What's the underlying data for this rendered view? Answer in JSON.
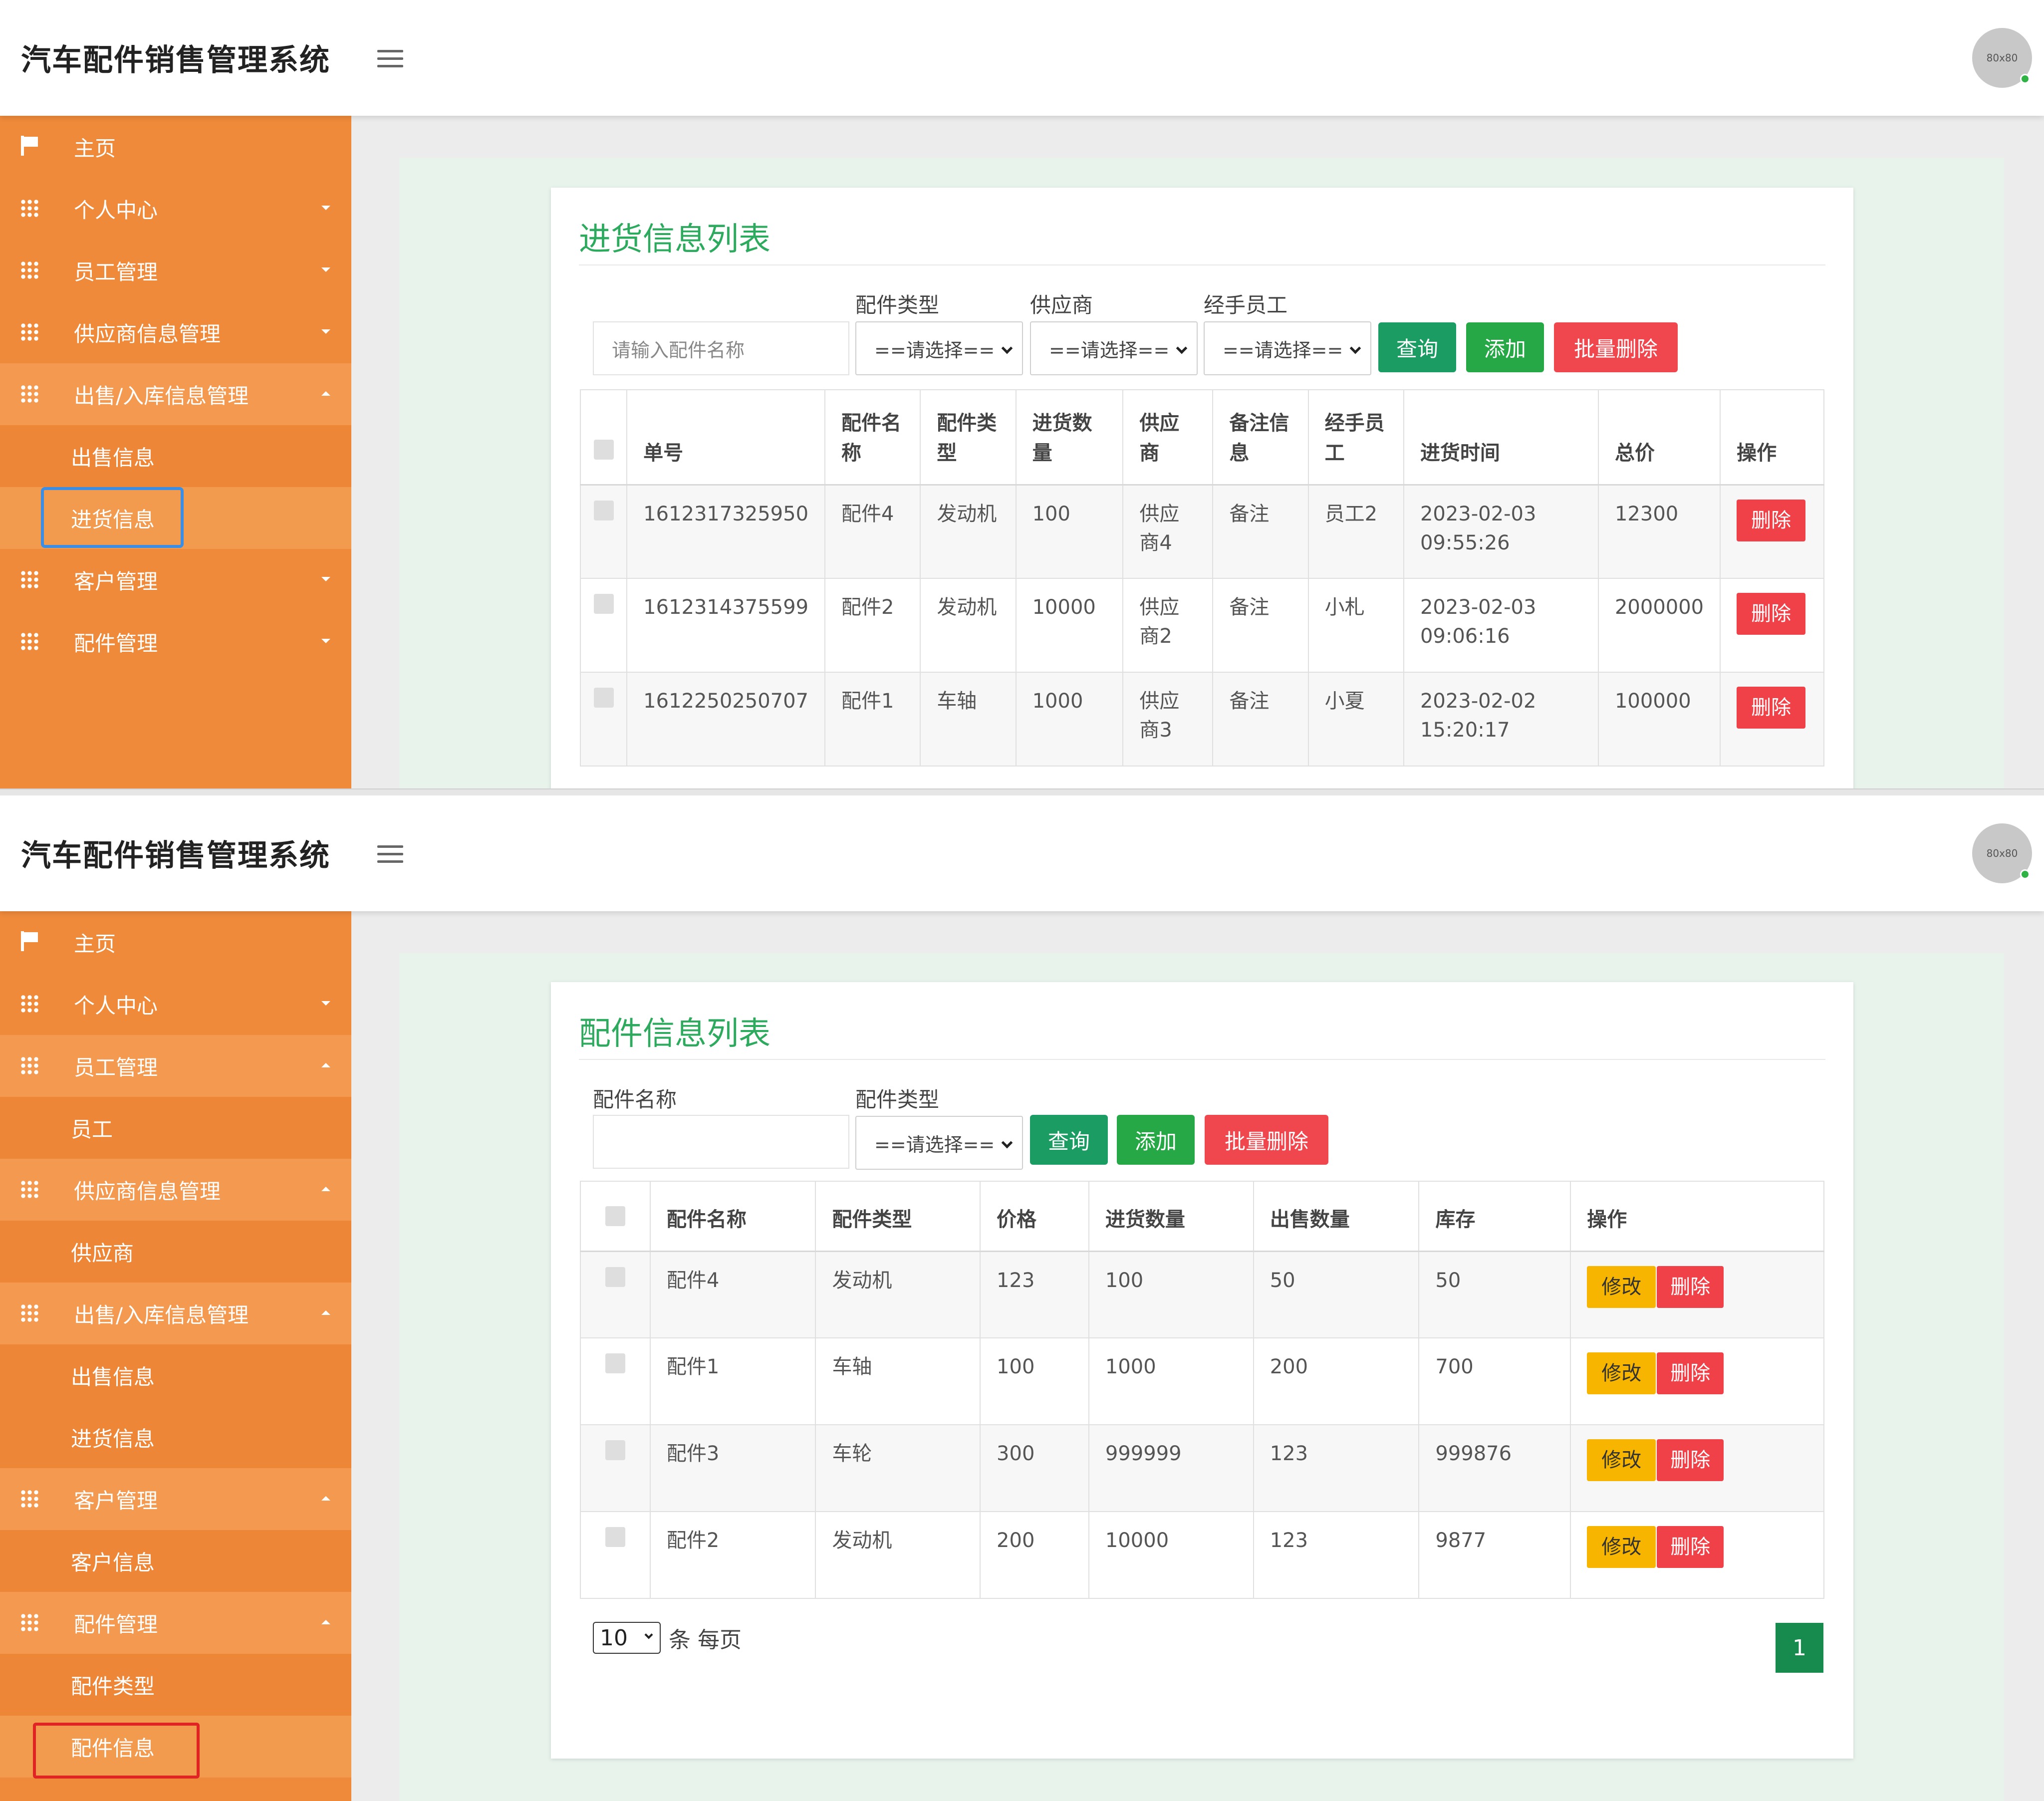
{
  "app_title": "汽车配件销售管理系统",
  "avatar_text": "80x80",
  "colors": {
    "sidebar": "#ef8a3a",
    "accent_green": "#2eaa5f",
    "danger": "#f04048",
    "warning": "#f7b500"
  },
  "shot1": {
    "sidebar": {
      "home": "主页",
      "personal": "个人中心",
      "staff": "员工管理",
      "supplier": "供应商信息管理",
      "inout": "出售/入库信息管理",
      "sales": "出售信息",
      "purchase": "进货信息",
      "customer": "客户管理",
      "parts": "配件管理"
    },
    "panel_title": "进货信息列表",
    "filters": {
      "name_placeholder": "请输入配件名称",
      "type_label": "配件类型",
      "supplier_label": "供应商",
      "staff_label": "经手员工",
      "select_default": "==请选择=="
    },
    "buttons": {
      "query": "查询",
      "add": "添加",
      "batch_delete": "批量删除",
      "delete": "删除"
    },
    "table": {
      "headers": {
        "order": "单号",
        "name": "配件名称",
        "type": "配件类型",
        "qty": "进货数量",
        "supplier": "供应商",
        "remark": "备注信息",
        "staff": "经手员工",
        "time": "进货时间",
        "total": "总价",
        "ops": "操作"
      },
      "rows": [
        {
          "order": "1612317325950",
          "name": "配件4",
          "type": "发动机",
          "qty": "100",
          "supplier": "供应商4",
          "remark": "备注",
          "staff": "员工2",
          "time": "2023-02-03 09:55:26",
          "total": "12300"
        },
        {
          "order": "1612314375599",
          "name": "配件2",
          "type": "发动机",
          "qty": "10000",
          "supplier": "供应商2",
          "remark": "备注",
          "staff": "小札",
          "time": "2023-02-03 09:06:16",
          "total": "2000000"
        },
        {
          "order": "1612250250707",
          "name": "配件1",
          "type": "车轴",
          "qty": "1000",
          "supplier": "供应商3",
          "remark": "备注",
          "staff": "小夏",
          "time": "2023-02-02 15:20:17",
          "total": "100000"
        }
      ]
    }
  },
  "shot2": {
    "sidebar": {
      "home": "主页",
      "personal": "个人中心",
      "staff": "员工管理",
      "staff_child": "员工",
      "supplier": "供应商信息管理",
      "supplier_child": "供应商",
      "inout": "出售/入库信息管理",
      "sales": "出售信息",
      "purchase": "进货信息",
      "customer": "客户管理",
      "customer_child": "客户信息",
      "parts": "配件管理",
      "parts_type": "配件类型",
      "parts_info": "配件信息"
    },
    "panel_title": "配件信息列表",
    "filters": {
      "name_label": "配件名称",
      "type_label": "配件类型",
      "select_default": "==请选择=="
    },
    "buttons": {
      "query": "查询",
      "add": "添加",
      "batch_delete": "批量删除",
      "edit": "修改",
      "delete": "删除"
    },
    "table": {
      "headers": {
        "name": "配件名称",
        "type": "配件类型",
        "price": "价格",
        "in_qty": "进货数量",
        "out_qty": "出售数量",
        "stock": "库存",
        "ops": "操作"
      },
      "rows": [
        {
          "name": "配件4",
          "type": "发动机",
          "price": "123",
          "in_qty": "100",
          "out_qty": "50",
          "stock": "50"
        },
        {
          "name": "配件1",
          "type": "车轴",
          "price": "100",
          "in_qty": "1000",
          "out_qty": "200",
          "stock": "700"
        },
        {
          "name": "配件3",
          "type": "车轮",
          "price": "300",
          "in_qty": "999999",
          "out_qty": "123",
          "stock": "999876"
        },
        {
          "name": "配件2",
          "type": "发动机",
          "price": "200",
          "in_qty": "10000",
          "out_qty": "123",
          "stock": "9877"
        }
      ]
    },
    "page_size": "10",
    "page_size_suffix": "条 每页",
    "current_page": "1"
  }
}
